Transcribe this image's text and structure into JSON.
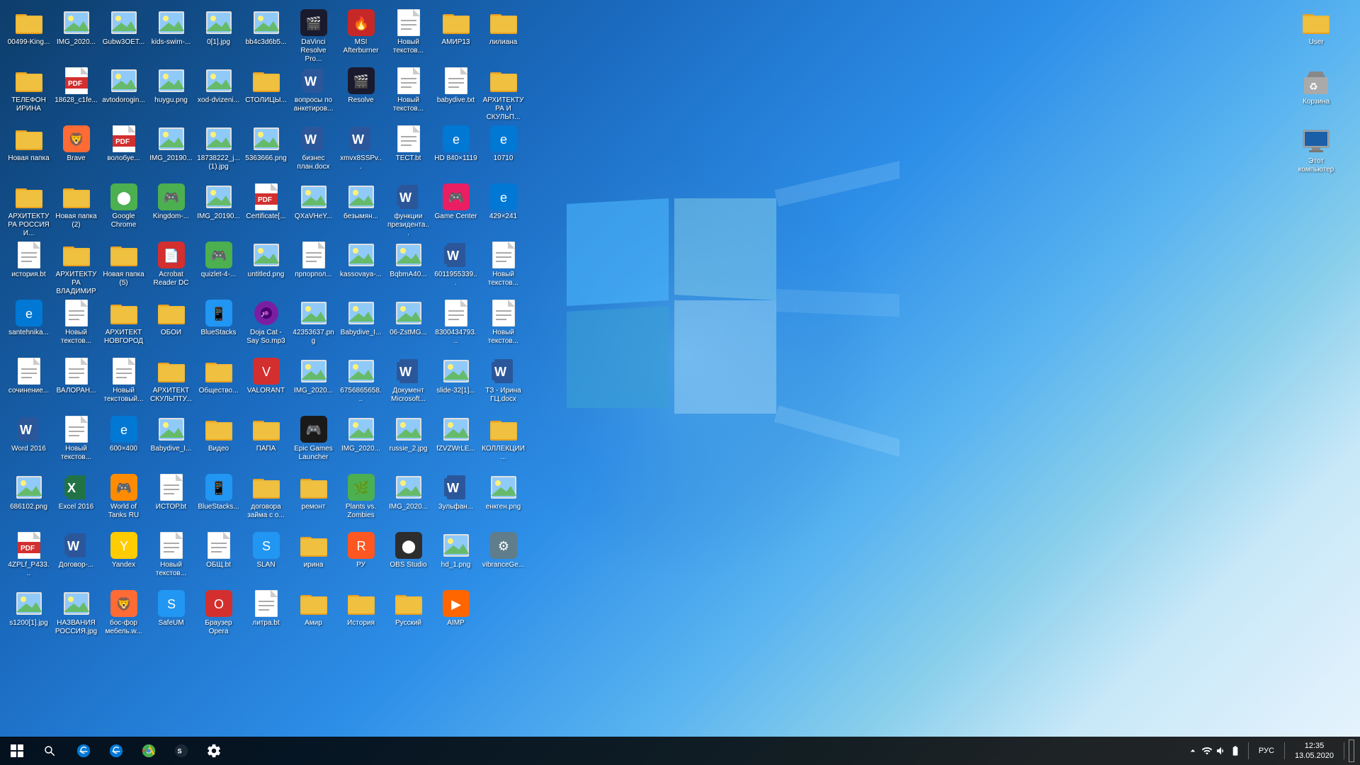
{
  "desktop": {
    "background_gradient": "blue windows",
    "icons": [
      {
        "id": "row1_1",
        "label": "00499-King...",
        "type": "folder",
        "color": "#e8a020"
      },
      {
        "id": "row1_2",
        "label": "IMG_2020...",
        "type": "image",
        "color": "#4a9eda"
      },
      {
        "id": "row1_3",
        "label": "Gubw3OET...",
        "type": "image",
        "color": "#4a9eda"
      },
      {
        "id": "row1_4",
        "label": "kids-swim-...",
        "type": "image",
        "color": "#4a9eda"
      },
      {
        "id": "row1_5",
        "label": "0[1].jpg",
        "type": "image",
        "color": "#4a9eda"
      },
      {
        "id": "row1_6",
        "label": "bb4c3d6b5...",
        "type": "image",
        "color": "#4a9eda"
      },
      {
        "id": "row1_7",
        "label": "DaVinci Resolve Pro...",
        "type": "app",
        "color": "#1a1a2e",
        "emoji": "🎬"
      },
      {
        "id": "row1_8",
        "label": "MSI Afterburner",
        "type": "app",
        "color": "#c62828",
        "emoji": "🔥"
      },
      {
        "id": "row1_9",
        "label": "Новый текстов...",
        "type": "txt",
        "color": "white"
      },
      {
        "id": "row1_10",
        "label": "АМИР13",
        "type": "folder",
        "color": "#e8a020"
      },
      {
        "id": "row1_11",
        "label": "лилиана",
        "type": "folder",
        "color": "#e8a020"
      },
      {
        "id": "row1_12",
        "label": "ТЕЛЕФОН ИРИНА",
        "type": "folder",
        "color": "#e8a020"
      },
      {
        "id": "row2_1",
        "label": "18628_c1fe...",
        "type": "pdf",
        "color": "#d32f2f"
      },
      {
        "id": "row2_2",
        "label": "avtodorogin...",
        "type": "image",
        "color": "#4a9eda"
      },
      {
        "id": "row2_3",
        "label": "huygu.png",
        "type": "image",
        "color": "#4a9eda"
      },
      {
        "id": "row2_4",
        "label": "xod-dvizeni...",
        "type": "image",
        "color": "#4a9eda"
      },
      {
        "id": "row2_5",
        "label": "СТОЛИЦЫ...",
        "type": "folder",
        "color": "#e8a020"
      },
      {
        "id": "row2_6",
        "label": "вопросы по анкетиров...",
        "type": "word",
        "color": "#2b579a"
      },
      {
        "id": "row2_7",
        "label": "Resolve",
        "type": "app",
        "color": "#1a1a2e",
        "emoji": "🎬"
      },
      {
        "id": "row2_8",
        "label": "Новый текстов...",
        "type": "txt",
        "color": "white"
      },
      {
        "id": "row2_9",
        "label": "babydive.txt",
        "type": "txt",
        "color": "white"
      },
      {
        "id": "row2_10",
        "label": "АРХИТЕКТУРА И СКУЛЬП...",
        "type": "folder",
        "color": "#e8a020"
      },
      {
        "id": "row2_11",
        "label": "Новая папка",
        "type": "folder",
        "color": "#e8a020"
      },
      {
        "id": "row2_12",
        "label": "Brave",
        "type": "app",
        "color": "#ff6b35",
        "emoji": "🦁"
      },
      {
        "id": "row3_1",
        "label": "волобуе...",
        "type": "pdf",
        "color": "#d32f2f"
      },
      {
        "id": "row3_2",
        "label": "IMG_20190...",
        "type": "image",
        "color": "#4a9eda"
      },
      {
        "id": "row3_3",
        "label": "18738222_j... (1).jpg",
        "type": "image",
        "color": "#4a9eda"
      },
      {
        "id": "row3_4",
        "label": "5363666.png",
        "type": "image",
        "color": "#4a9eda"
      },
      {
        "id": "row3_5",
        "label": "бизнес план.docx",
        "type": "word",
        "color": "#2b579a"
      },
      {
        "id": "row3_6",
        "label": "xmvx8SSPv...",
        "type": "word",
        "color": "#2b579a"
      },
      {
        "id": "row3_7",
        "label": "ТЕСТ.bt",
        "type": "txt",
        "color": "white"
      },
      {
        "id": "row3_8",
        "label": "HD 840×1119",
        "type": "app",
        "color": "#0078d4",
        "emoji": "e"
      },
      {
        "id": "row3_9",
        "label": "10710",
        "type": "app",
        "color": "#0078d4",
        "emoji": "e"
      },
      {
        "id": "row3_10",
        "label": "АРХИТЕКТУРА РОССИЯ И...",
        "type": "folder",
        "color": "#e8a020"
      },
      {
        "id": "row3_11",
        "label": "Новая папка (2)",
        "type": "folder",
        "color": "#e8a020"
      },
      {
        "id": "row3_12",
        "label": "Google Chrome",
        "type": "app",
        "color": "#4caf50",
        "emoji": "⬤"
      },
      {
        "id": "row4_1",
        "label": "Kingdom-...",
        "type": "app",
        "color": "#4CAF50",
        "emoji": "🎮"
      },
      {
        "id": "row4_2",
        "label": "IMG_20190...",
        "type": "image",
        "color": "#4a9eda"
      },
      {
        "id": "row4_3",
        "label": "Certificate[...",
        "type": "pdf",
        "color": "#d32f2f"
      },
      {
        "id": "row4_4",
        "label": "QXaVHeY...",
        "type": "image",
        "color": "#4a9eda"
      },
      {
        "id": "row4_5",
        "label": "безымян...",
        "type": "image",
        "color": "#4a9eda"
      },
      {
        "id": "row4_6",
        "label": "функции президента...",
        "type": "word",
        "color": "#2b579a"
      },
      {
        "id": "row4_7",
        "label": "Game Center",
        "type": "app",
        "color": "#e91e63",
        "emoji": "🎮"
      },
      {
        "id": "row4_8",
        "label": "429×241",
        "type": "app",
        "color": "#0078d4",
        "emoji": "e"
      },
      {
        "id": "row4_9",
        "label": "история.bt",
        "type": "txt",
        "color": "white"
      },
      {
        "id": "row4_10",
        "label": "АРХИТЕКТУРА ВЛАДИМИР",
        "type": "folder",
        "color": "#e8a020"
      },
      {
        "id": "row4_11",
        "label": "Новая папка (5)",
        "type": "folder",
        "color": "#e8a020"
      },
      {
        "id": "row4_12",
        "label": "Acrobat Reader DC",
        "type": "app",
        "color": "#d32f2f",
        "emoji": "📄"
      },
      {
        "id": "row5_1",
        "label": "quizlet-4-...",
        "type": "app",
        "color": "#4CAF50",
        "emoji": "🎮"
      },
      {
        "id": "row5_2",
        "label": "untitled.png",
        "type": "image",
        "color": "#4a9eda"
      },
      {
        "id": "row5_3",
        "label": "прпорпол...",
        "type": "txt",
        "color": "white"
      },
      {
        "id": "row5_4",
        "label": "kassovaya-...",
        "type": "image",
        "color": "#4a9eda"
      },
      {
        "id": "row5_5",
        "label": "BqbmA40...",
        "type": "image",
        "color": "#4a9eda"
      },
      {
        "id": "row5_6",
        "label": "6011955339...",
        "type": "word",
        "color": "#2b579a"
      },
      {
        "id": "row5_7",
        "label": "Новый текстов...",
        "type": "txt",
        "color": "white"
      },
      {
        "id": "row5_8",
        "label": "santehnika...",
        "type": "app",
        "color": "#0078d4",
        "emoji": "e"
      },
      {
        "id": "row5_9",
        "label": "Новый текстов...",
        "type": "txt",
        "color": "white"
      },
      {
        "id": "row5_10",
        "label": "АРХИТЕКТ НОВГОРОД",
        "type": "folder",
        "color": "#e8a020"
      },
      {
        "id": "row5_11",
        "label": "ОБОИ",
        "type": "folder",
        "color": "#e8a020"
      },
      {
        "id": "row5_12",
        "label": "BlueStacks",
        "type": "app",
        "color": "#2196f3",
        "emoji": "📱"
      },
      {
        "id": "row6_1",
        "label": "Doja Cat - Say So.mp3",
        "type": "audio",
        "color": "#9c27b0"
      },
      {
        "id": "row6_2",
        "label": "42353637.png",
        "type": "image",
        "color": "#4a9eda"
      },
      {
        "id": "row6_3",
        "label": "Babydive_I...",
        "type": "image",
        "color": "#4a9eda"
      },
      {
        "id": "row6_4",
        "label": "06-ZstMG...",
        "type": "image",
        "color": "#4a9eda"
      },
      {
        "id": "row6_5",
        "label": "8300434793...",
        "type": "txt",
        "color": "white"
      },
      {
        "id": "row6_6",
        "label": "Новый текстов...",
        "type": "txt",
        "color": "white"
      },
      {
        "id": "row6_7",
        "label": "сочинение...",
        "type": "txt",
        "color": "white"
      },
      {
        "id": "row6_8",
        "label": "ВАЛОРАН...",
        "type": "txt",
        "color": "white"
      },
      {
        "id": "row6_9",
        "label": "Новый текстовый...",
        "type": "txt",
        "color": "white"
      },
      {
        "id": "row6_10",
        "label": "АРХИТЕКТ СКУЛЬПТУ...",
        "type": "folder",
        "color": "#e8a020"
      },
      {
        "id": "row6_11",
        "label": "Общество...",
        "type": "folder",
        "color": "#e8a020"
      },
      {
        "id": "row6_12",
        "label": "VALORANT",
        "type": "app",
        "color": "#d32f2f",
        "emoji": "V"
      },
      {
        "id": "row7_1",
        "label": "IMG_2020...",
        "type": "image",
        "color": "#4a9eda"
      },
      {
        "id": "row7_2",
        "label": "6756865658...",
        "type": "image",
        "color": "#4a9eda"
      },
      {
        "id": "row7_3",
        "label": "Документ Microsoft...",
        "type": "word",
        "color": "#2b579a"
      },
      {
        "id": "row7_4",
        "label": "slide-32[1]...",
        "type": "image",
        "color": "#4a9eda"
      },
      {
        "id": "row7_5",
        "label": "ТЗ - Ирина ГЦ.docx",
        "type": "word",
        "color": "#2b579a"
      },
      {
        "id": "row7_6",
        "label": "Word 2016",
        "type": "word",
        "color": "#2b579a"
      },
      {
        "id": "row7_7",
        "label": "Новый текстов...",
        "type": "txt",
        "color": "white"
      },
      {
        "id": "row7_8",
        "label": "600×400",
        "type": "app",
        "color": "#0078d4",
        "emoji": "e"
      },
      {
        "id": "row7_9",
        "label": "Babydive_I...",
        "type": "image",
        "color": "#4a9eda"
      },
      {
        "id": "row7_10",
        "label": "Видео",
        "type": "folder",
        "color": "#e8a020"
      },
      {
        "id": "row7_11",
        "label": "ПАПА",
        "type": "folder",
        "color": "#e8a020"
      },
      {
        "id": "row7_12",
        "label": "Epic Games Launcher",
        "type": "app",
        "color": "#1a1a1a",
        "emoji": "🎮"
      },
      {
        "id": "row8_1",
        "label": "IMG_2020...",
        "type": "image",
        "color": "#4a9eda"
      },
      {
        "id": "row8_2",
        "label": "russie_2.jpg",
        "type": "image",
        "color": "#4a9eda"
      },
      {
        "id": "row8_3",
        "label": "fZVZWrLE...",
        "type": "image",
        "color": "#4a9eda"
      },
      {
        "id": "row8_4",
        "label": "КОЛЛЕКЦИИ...",
        "type": "folder",
        "color": "#e8a020"
      },
      {
        "id": "row8_5",
        "label": "686102.png",
        "type": "image",
        "color": "#4a9eda"
      },
      {
        "id": "row8_6",
        "label": "Excel 2016",
        "type": "excel",
        "color": "#217346"
      },
      {
        "id": "row8_7",
        "label": "World of Tanks RU",
        "type": "app",
        "color": "#ff8c00",
        "emoji": "🎮"
      },
      {
        "id": "row8_8",
        "label": "ИСТОР.bt",
        "type": "txt",
        "color": "white"
      },
      {
        "id": "row8_9",
        "label": "BlueStacks...",
        "type": "app",
        "color": "#2196f3",
        "emoji": "📱"
      },
      {
        "id": "row8_10",
        "label": "договора займа с о...",
        "type": "folder",
        "color": "#e8a020"
      },
      {
        "id": "row8_11",
        "label": "ремонт",
        "type": "folder",
        "color": "#e8a020"
      },
      {
        "id": "row8_12",
        "label": "Plants vs. Zombies",
        "type": "app",
        "color": "#4caf50",
        "emoji": "🌿"
      },
      {
        "id": "row9_1",
        "label": "IMG_2020...",
        "type": "image",
        "color": "#4a9eda"
      },
      {
        "id": "row9_2",
        "label": "3ульфан...",
        "type": "word",
        "color": "#2b579a"
      },
      {
        "id": "row9_3",
        "label": "енкген.png",
        "type": "image",
        "color": "#4a9eda"
      },
      {
        "id": "row9_4",
        "label": "4ZPLf_P433...",
        "type": "pdf",
        "color": "#d32f2f"
      },
      {
        "id": "row9_5",
        "label": "Договор-...",
        "type": "word",
        "color": "#2b579a"
      },
      {
        "id": "row9_6",
        "label": "Yandex",
        "type": "app",
        "color": "#ffcc00",
        "emoji": "Y"
      },
      {
        "id": "row9_7",
        "label": "Новый текстов...",
        "type": "txt",
        "color": "white"
      },
      {
        "id": "row9_8",
        "label": "ОБЩ.bt",
        "type": "txt",
        "color": "white"
      },
      {
        "id": "row9_9",
        "label": "SLAN",
        "type": "app",
        "color": "#2196f3",
        "emoji": "S"
      },
      {
        "id": "row9_10",
        "label": "ирина",
        "type": "folder",
        "color": "#e8a020"
      },
      {
        "id": "row9_11",
        "label": "РУ",
        "type": "app",
        "color": "#ff5722",
        "emoji": "R"
      },
      {
        "id": "row9_12",
        "label": "OBS Studio",
        "type": "app",
        "color": "#2d2d2d",
        "emoji": "⬤"
      },
      {
        "id": "row10_1",
        "label": "hd_1.png",
        "type": "image",
        "color": "#4a9eda"
      },
      {
        "id": "row10_2",
        "label": "vibranceGe...",
        "type": "app",
        "color": "#607d8b",
        "emoji": "⚙"
      },
      {
        "id": "row10_3",
        "label": "s1200[1].jpg",
        "type": "image",
        "color": "#4a9eda"
      },
      {
        "id": "row10_4",
        "label": "НАЗВАНИЯ РОССИЯ.jpg",
        "type": "image",
        "color": "#4a9eda"
      },
      {
        "id": "row10_5",
        "label": "бос-фор мебель.w...",
        "type": "app",
        "color": "#ff6b35",
        "emoji": "🦁"
      },
      {
        "id": "row10_6",
        "label": "SafeUM",
        "type": "app",
        "color": "#2196f3",
        "emoji": "S"
      },
      {
        "id": "row10_7",
        "label": "Браузер Opera",
        "type": "app",
        "color": "#d32f2f",
        "emoji": "O"
      },
      {
        "id": "row10_8",
        "label": "литра.bt",
        "type": "txt",
        "color": "white"
      },
      {
        "id": "row10_9",
        "label": "Амир",
        "type": "folder",
        "color": "#e8a020"
      },
      {
        "id": "row10_10",
        "label": "История",
        "type": "folder",
        "color": "#e8a020"
      },
      {
        "id": "row10_11",
        "label": "Русский",
        "type": "folder",
        "color": "#e8a020"
      },
      {
        "id": "row10_12",
        "label": "AIMP",
        "type": "app",
        "color": "#ff6600",
        "emoji": "▶"
      }
    ],
    "right_icons": [
      {
        "id": "r1",
        "label": "User",
        "type": "folder_user",
        "color": "#e8a020",
        "emoji": "👤"
      },
      {
        "id": "r2",
        "label": "Корзина",
        "type": "recycle",
        "color": "#607d8b",
        "emoji": "🗑"
      },
      {
        "id": "r3",
        "label": "Этот компьютер",
        "type": "computer",
        "color": "#607d8b",
        "emoji": "🖥"
      }
    ]
  },
  "taskbar": {
    "start_label": "⊞",
    "search_icon": "🔍",
    "time": "12:35",
    "date": "13.05.2020",
    "language": "РУС",
    "pinned_icons": [
      {
        "id": "tb1",
        "emoji": "e",
        "color": "#0078d4",
        "label": "Edge"
      },
      {
        "id": "tb2",
        "emoji": "e",
        "color": "#0078d4",
        "label": "Edge2"
      },
      {
        "id": "tb3",
        "emoji": "🟢",
        "color": "#4caf50",
        "label": "Chrome"
      },
      {
        "id": "tb4",
        "emoji": "♻",
        "color": "#607d8b",
        "label": "Steam"
      }
    ]
  }
}
